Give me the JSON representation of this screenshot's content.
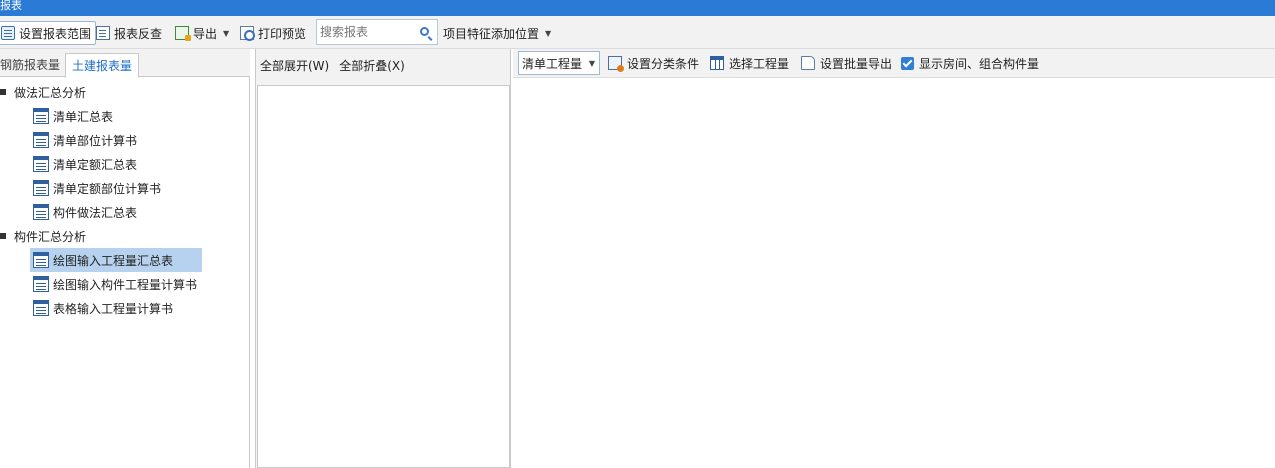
{
  "window": {
    "title": "报表"
  },
  "toolbar": {
    "set_range_label": "设置报表范围",
    "report_check_label": "报表反查",
    "export_label": "导出",
    "print_preview_label": "打印预览",
    "search_placeholder": "搜索报表",
    "feature_position_label": "项目特征添加位置"
  },
  "left_panel": {
    "tabs": [
      {
        "label": "钢筋报表量"
      },
      {
        "label": "土建报表量"
      }
    ],
    "groups": [
      {
        "label": "做法汇总分析",
        "items": [
          {
            "label": "清单汇总表"
          },
          {
            "label": "清单部位计算书"
          },
          {
            "label": "清单定额汇总表"
          },
          {
            "label": "清单定额部位计算书"
          },
          {
            "label": "构件做法汇总表"
          }
        ]
      },
      {
        "label": "构件汇总分析",
        "items": [
          {
            "label": "绘图输入工程量汇总表"
          },
          {
            "label": "绘图输入构件工程量计算书"
          },
          {
            "label": "表格输入工程量计算书"
          }
        ]
      }
    ],
    "selected_item": "绘图输入工程量汇总表"
  },
  "middle_panel": {
    "expand_all_label": "全部展开(W)",
    "collapse_all_label": "全部折叠(X)"
  },
  "right_panel": {
    "quantity_select_value": "清单工程量",
    "set_category_label": "设置分类条件",
    "select_quantity_label": "选择工程量",
    "batch_export_label": "设置批量导出",
    "show_room_label": "显示房间、组合构件量",
    "show_room_checked": true
  }
}
